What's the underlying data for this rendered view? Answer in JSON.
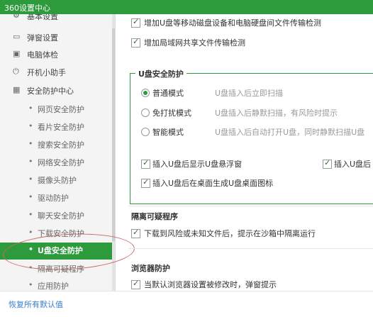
{
  "window": {
    "title": "360设置中心"
  },
  "sidebar": {
    "items": [
      {
        "label": "基本设置",
        "icon": "settings-icon"
      },
      {
        "label": "弹窗设置",
        "icon": "window-icon"
      },
      {
        "label": "电脑体检",
        "icon": "monitor-icon"
      },
      {
        "label": "开机小助手",
        "icon": "power-icon"
      },
      {
        "label": "安全防护中心",
        "icon": "shield-grid-icon"
      }
    ],
    "subitems": [
      "网页安全防护",
      "看片安全防护",
      "搜索安全防护",
      "网络安全防护",
      "摄像头防护",
      "驱动防护",
      "聊天安全防护",
      "下载安全防护",
      "U盘安全防护",
      "隔离可疑程序",
      "应用防护"
    ],
    "active_subitem": "U盘安全防护",
    "bullet": "•"
  },
  "footer": {
    "reset_label": "恢复所有默认值"
  },
  "main": {
    "top_options": [
      {
        "label": "增加U盘等移动磁盘设备和电脑硬盘间文件传输检测",
        "checked": true
      },
      {
        "label": "增加局域网共享文件传输检测",
        "checked": true
      }
    ],
    "usb": {
      "title": "U盘安全防护",
      "modes": [
        {
          "label": "普通模式",
          "desc": "U盘插入后立即扫描",
          "selected": true
        },
        {
          "label": "免打扰模式",
          "desc": "U盘插入后静默扫描，有风险时提示",
          "selected": false
        },
        {
          "label": "智能模式",
          "desc": "U盘插入后自动打开U盘，同时静默扫描U盘",
          "selected": false
        }
      ],
      "options": [
        {
          "label": "插入U盘后显示U盘悬浮窗",
          "checked": true
        },
        {
          "label": "插入U盘后",
          "checked": true
        },
        {
          "label": "插入U盘后在桌面生成U盘桌面图标",
          "checked": true
        }
      ]
    },
    "quarantine": {
      "title": "隔离可疑程序",
      "option": {
        "label": "下载到风险或未知文件后，提示在沙箱中隔离运行",
        "checked": true
      }
    },
    "browser": {
      "title": "浏览器防护",
      "option": {
        "label": "当默认浏览器设置被修改时，弹窗提示",
        "checked": true
      }
    }
  },
  "colors": {
    "accent": "#2d9a3c",
    "link": "#3a7ecf",
    "highlight": "#c86a6a"
  }
}
